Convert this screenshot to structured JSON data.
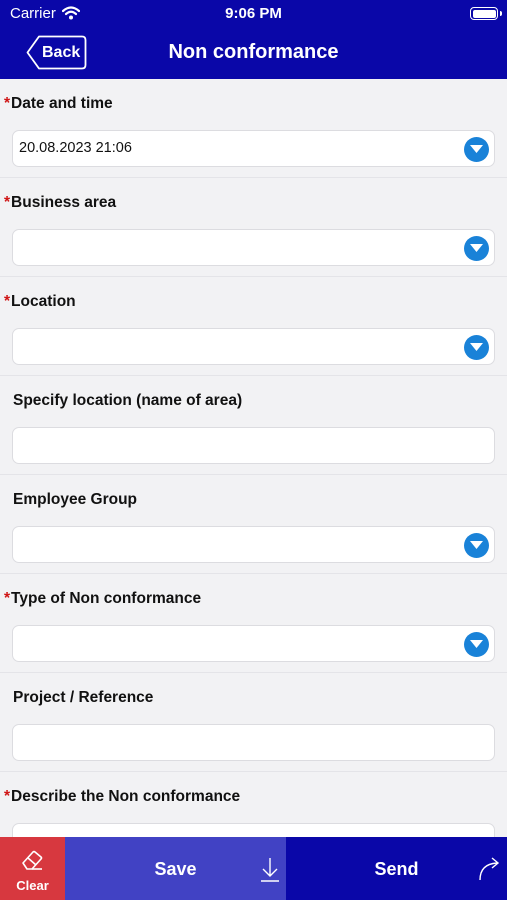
{
  "status_bar": {
    "carrier": "Carrier",
    "time": "9:06 PM"
  },
  "nav": {
    "back_label": "Back",
    "title": "Non conformance"
  },
  "fields": [
    {
      "label": "Date and time",
      "required": true,
      "value": "20.08.2023 21:06",
      "type": "dropdown"
    },
    {
      "label": "Business area",
      "required": true,
      "value": "",
      "type": "dropdown"
    },
    {
      "label": "Location",
      "required": true,
      "value": "",
      "type": "dropdown"
    },
    {
      "label": "Specify location (name of area)",
      "required": false,
      "value": "",
      "type": "text"
    },
    {
      "label": "Employee Group",
      "required": false,
      "value": "",
      "type": "dropdown"
    },
    {
      "label": "Type of Non conformance",
      "required": true,
      "value": "",
      "type": "dropdown"
    },
    {
      "label": "Project / Reference",
      "required": false,
      "value": "",
      "type": "text"
    },
    {
      "label": "Describe the Non conformance",
      "required": true,
      "value": "",
      "type": "text"
    }
  ],
  "toolbar": {
    "clear_label": "Clear",
    "save_label": "Save",
    "send_label": "Send"
  },
  "colors": {
    "header": "#0a07a8",
    "required_star": "#cf1414",
    "dropdown": "#1982d8",
    "clear": "#d7383f",
    "save": "#4142c4",
    "send": "#0a07a8"
  },
  "icons": {
    "wifi": "wifi-icon",
    "battery": "battery-icon",
    "back": "back-arrow-icon",
    "dropdown": "chevron-down-icon",
    "clear": "eraser-icon",
    "save": "download-arrow-icon",
    "send": "forward-arrow-icon"
  }
}
